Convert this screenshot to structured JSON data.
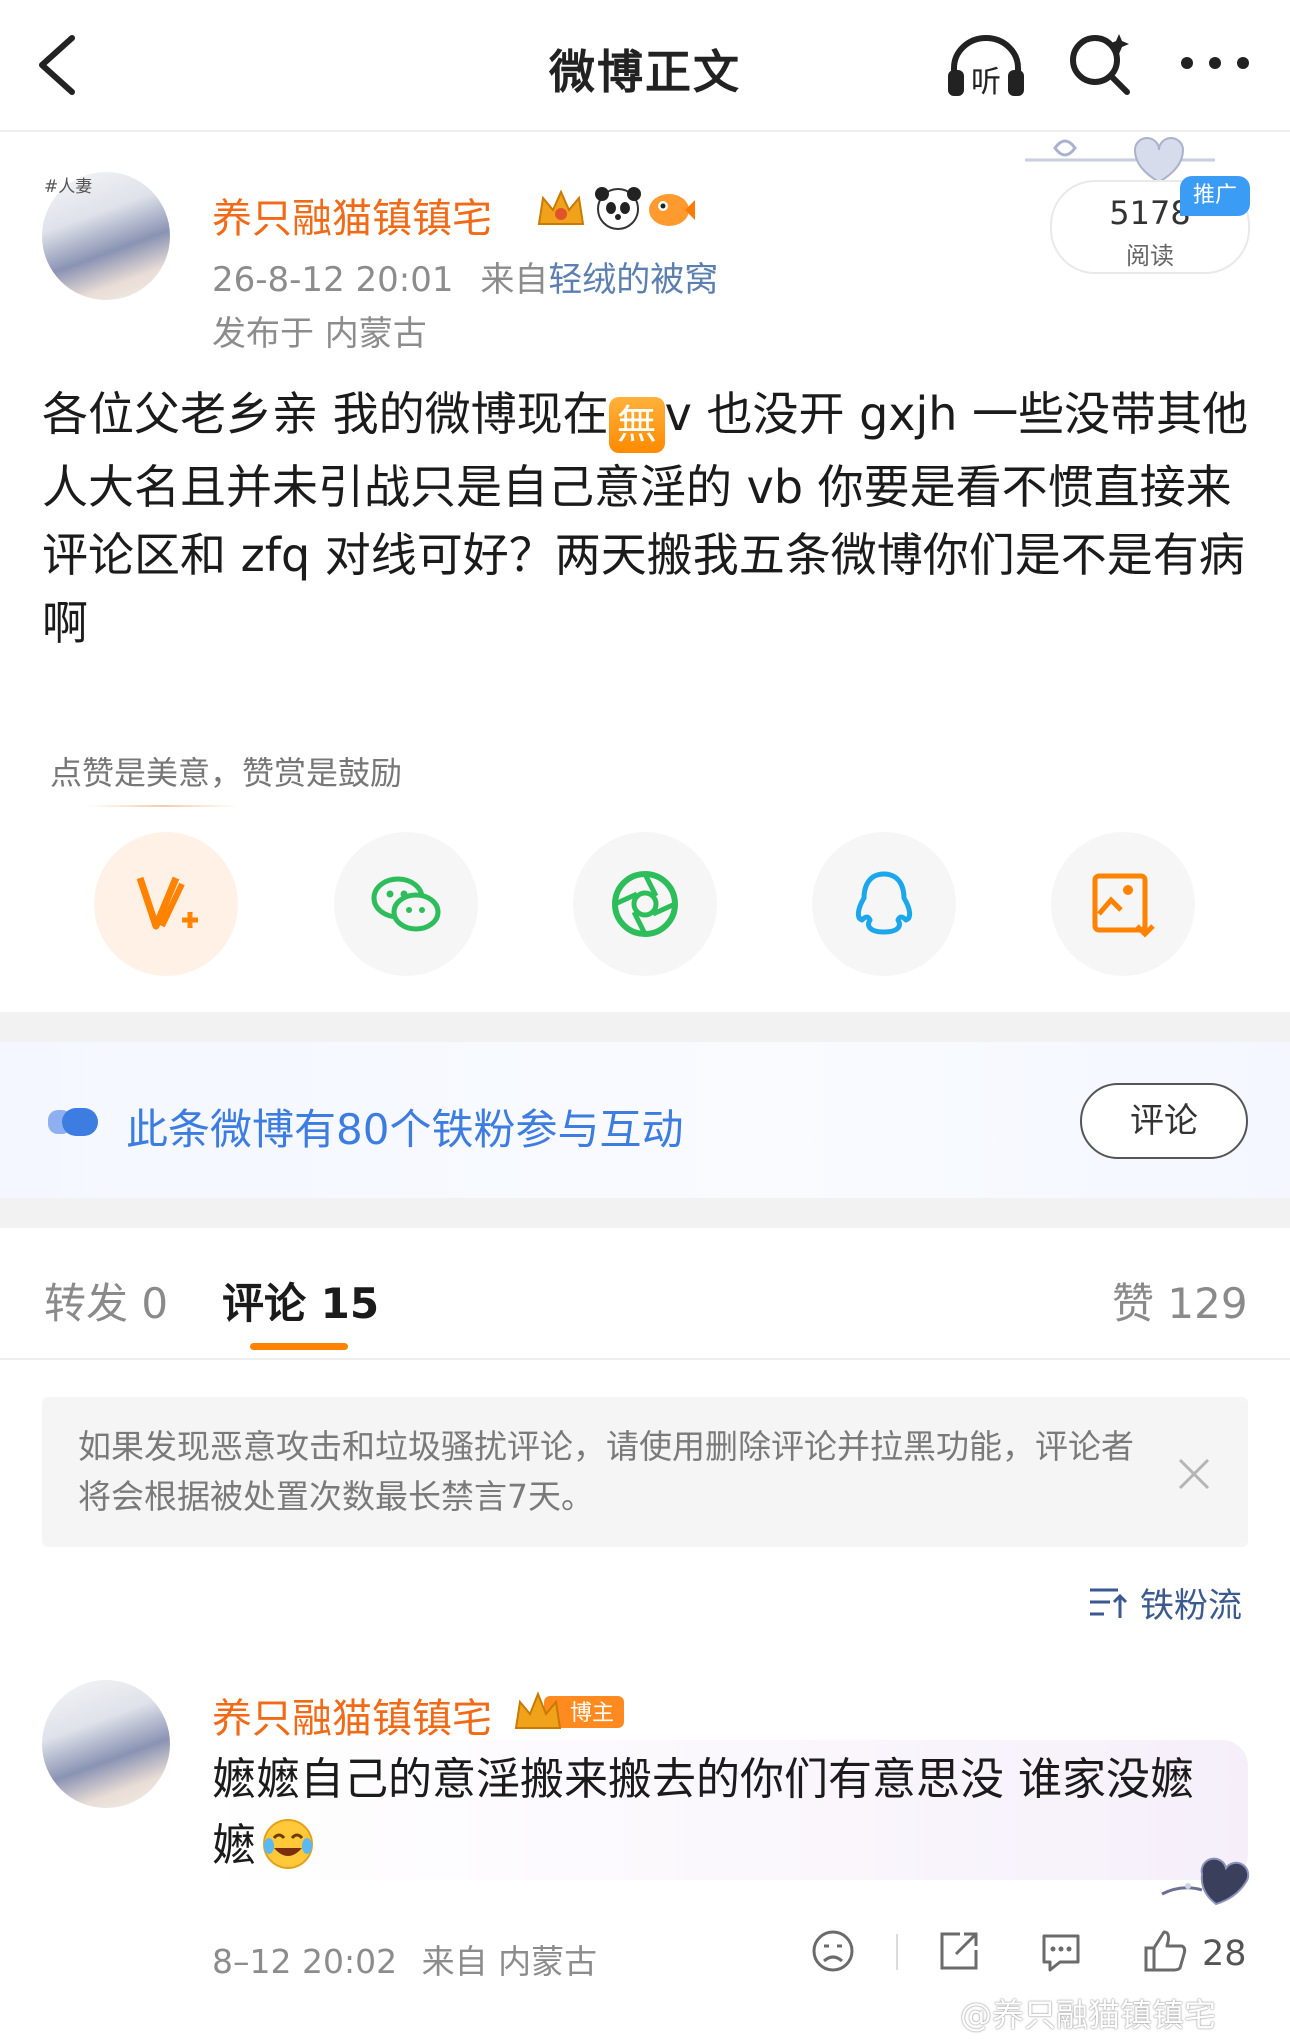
{
  "nav": {
    "title": "微博正文",
    "listen_label": "听"
  },
  "post": {
    "avatar_tag": "#人妻",
    "author": "养只融猫镇镇宅",
    "time": "26-8-12 20:01",
    "source_prefix": "来自",
    "source": "轻绒的被窝",
    "location": "发布于 内蒙古",
    "reads": "5178",
    "reads_label": "阅读",
    "promo": "推广",
    "text_before": "各位父老乡亲 我的微博现在",
    "emoji_wu": "無",
    "text_after": "v 也没开 gxjh 一些没带其他人大名且并未引战只是自己意淫的 vb 你要是看不惯直接来评论区和 zfq 对线可好？两天搬我五条微博你们是不是有病啊"
  },
  "share": {
    "reward_tip": "点赞是美意，赞赏是鼓励",
    "buttons": [
      "v-plus",
      "wechat",
      "moments",
      "qq",
      "save-image"
    ]
  },
  "fans": {
    "text": "此条微博有80个铁粉参与互动",
    "button": "评论"
  },
  "tabs": {
    "repost_label": "转发",
    "repost_count": "0",
    "comment_label": "评论",
    "comment_count": "15",
    "like_label": "赞",
    "like_count": "129"
  },
  "notice": {
    "text": "如果发现恶意攻击和垃圾骚扰评论，请使用删除评论并拉黑功能，评论者将会根据被处置次数最长禁言7天。"
  },
  "sort_label": "铁粉流",
  "comment": {
    "author": "养只融猫镇镇宅",
    "badge": "博主",
    "text": "嬷嬷自己的意淫搬来搬去的你们有意思没 谁家没嬷嬷",
    "time": "8–12 20:02",
    "source": "来自 内蒙古",
    "likes": "28"
  },
  "watermark": "@养只融猫镇镇宅",
  "colors": {
    "accent": "#ff8200",
    "name": "#f06a17",
    "link": "#3d7ce0"
  }
}
